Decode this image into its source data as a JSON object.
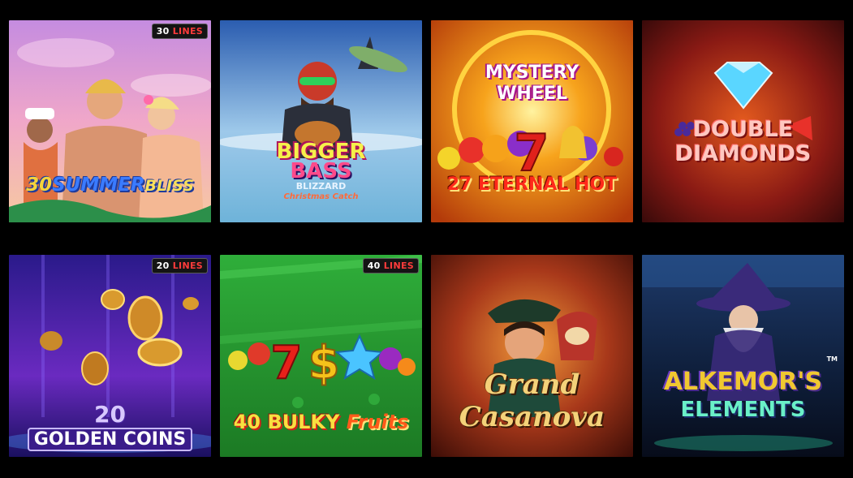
{
  "games": [
    {
      "title_a": "30",
      "title_b": "SUMMER",
      "title_c": "BLISS",
      "lines_num": "30",
      "lines_word": "LINES"
    },
    {
      "title_a": "BIGGER",
      "title_b": "BASS",
      "title_c": "BLIZZARD",
      "title_d": "Christmas Catch"
    },
    {
      "title_a": "MYSTERY",
      "title_b": "WHEEL",
      "title_c": "27 ETERNAL HOT"
    },
    {
      "title_a": "DOUBLE",
      "title_b": "DIAMONDS"
    },
    {
      "title_a": "20",
      "title_b": "GOLDEN COINS",
      "lines_num": "20",
      "lines_word": "LINES"
    },
    {
      "title_a": "40 BULKY",
      "title_b": "Fruits",
      "lines_num": "40",
      "lines_word": "LINES"
    },
    {
      "title_a": "Grand Casanova"
    },
    {
      "title_a": "ALKEMOR'S",
      "title_b": "ELEMENTS",
      "tm": "TM"
    }
  ]
}
